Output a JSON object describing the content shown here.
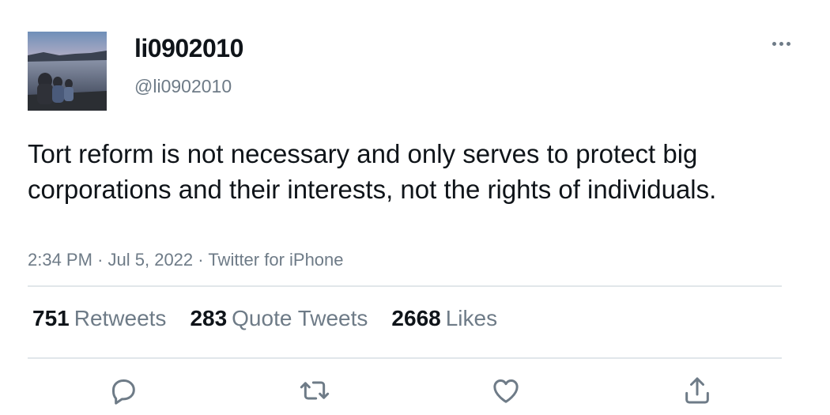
{
  "author": {
    "display_name": "li0902010",
    "handle": "@li0902010",
    "avatar_icon": "profile-photo-lakeside"
  },
  "tweet": {
    "text": "Tort reform is not necessary and only serves to protect big corporations and their interests, not the rights of individuals.",
    "time": "2:34 PM",
    "date": "Jul 5, 2022",
    "source": "Twitter for iPhone",
    "separator": "·"
  },
  "stats": {
    "retweets": {
      "count": "751",
      "label": "Retweets"
    },
    "quote_tweets": {
      "count": "283",
      "label": "Quote Tweets"
    },
    "likes": {
      "count": "2668",
      "label": "Likes"
    }
  },
  "actions": {
    "reply_icon": "reply-icon",
    "retweet_icon": "retweet-icon",
    "like_icon": "heart-icon",
    "share_icon": "share-icon"
  },
  "colors": {
    "text": "#0f1419",
    "secondary": "#6e7b87",
    "divider": "#e1e6ea"
  }
}
